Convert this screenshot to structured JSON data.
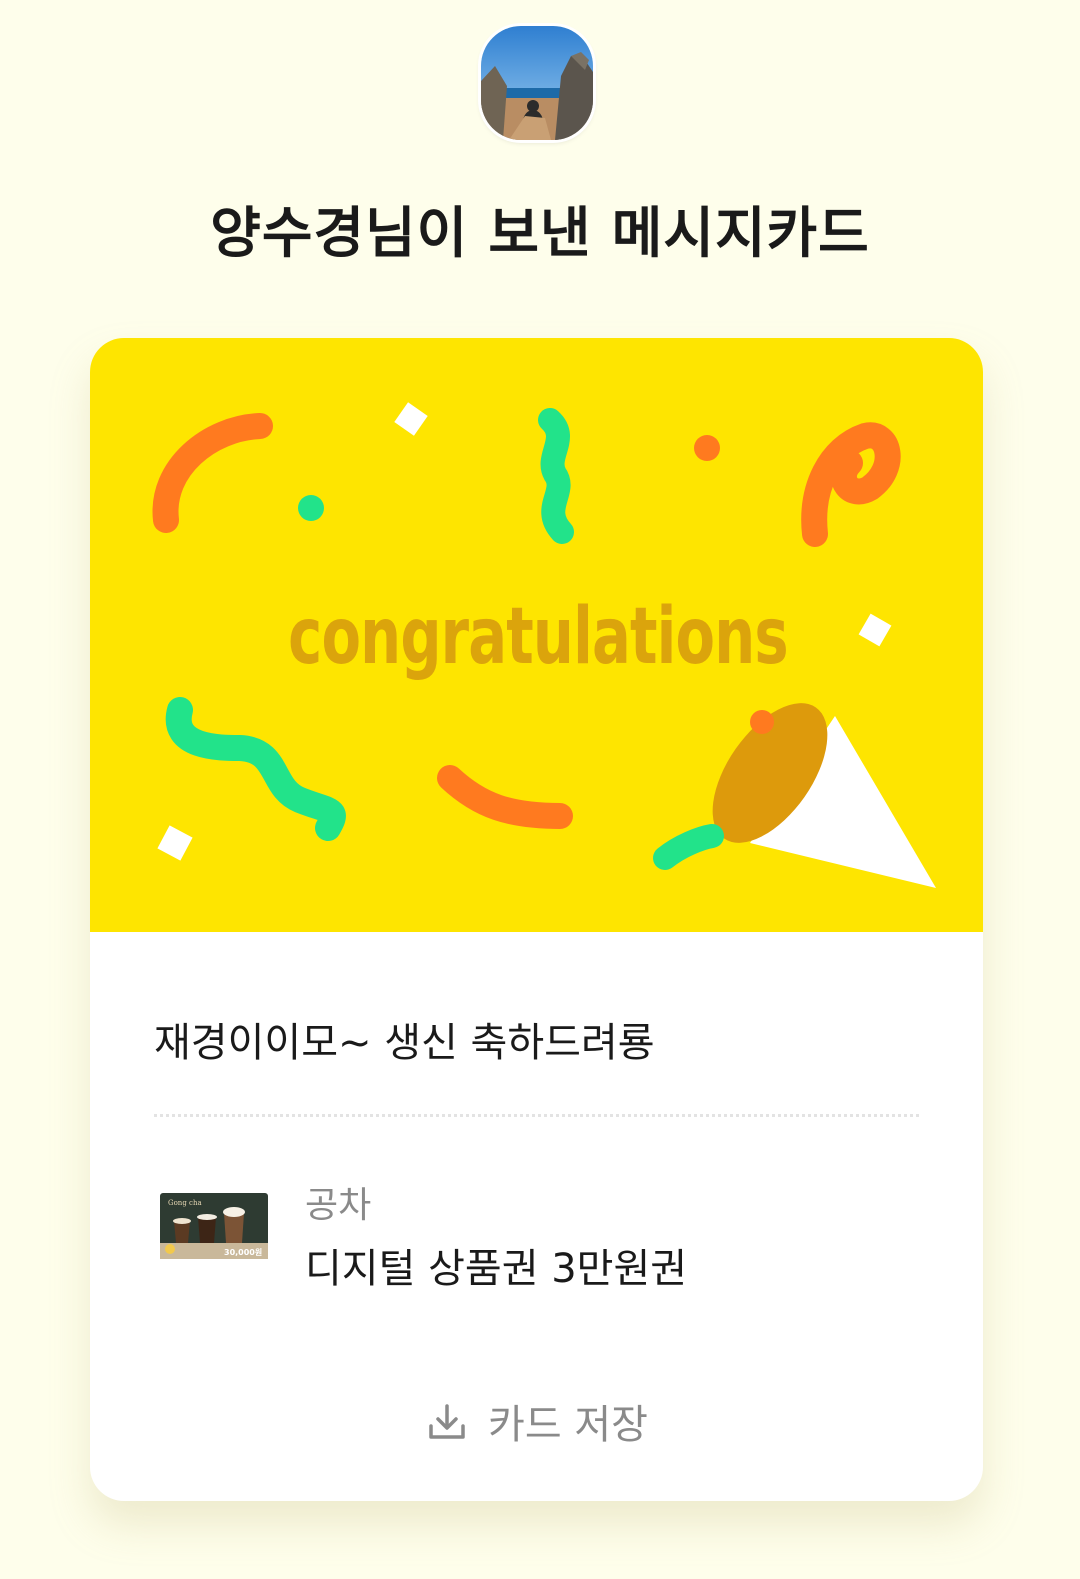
{
  "header": {
    "title": "양수경님이 보낸 메시지카드"
  },
  "card": {
    "art_text": "congratulations",
    "message": "재경이이모~ 생신 축하드려룡",
    "gift": {
      "brand": "공차",
      "name": "디지털 상품권 3만원권",
      "thumb_logo": "Gong cha",
      "thumb_price": "30,000원"
    },
    "save_button": {
      "label": "카드 저장",
      "icon": "download-icon"
    }
  },
  "colors": {
    "background": "#fefeeb",
    "card_art": "#fee500",
    "art_text": "#dba40c",
    "confetti_orange": "#ff7a1f",
    "confetti_green": "#22e38a"
  }
}
